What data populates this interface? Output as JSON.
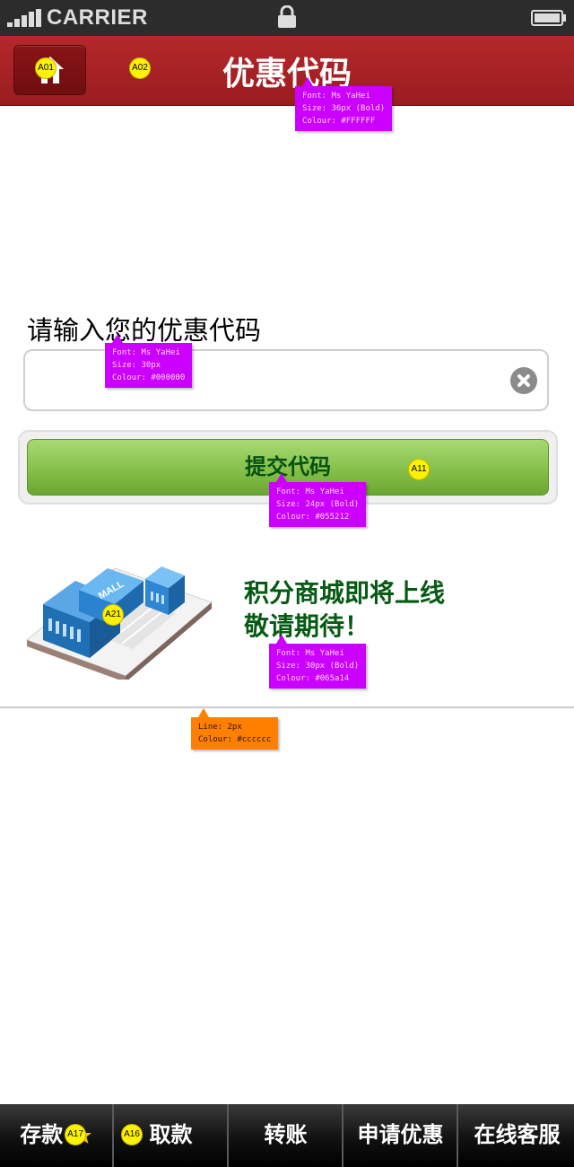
{
  "status_bar": {
    "carrier": "CARRIER",
    "signal_bars": 5,
    "icons": [
      "signal-icon",
      "lock-icon",
      "battery-icon"
    ]
  },
  "header": {
    "title": "优惠代码",
    "home_icon": "home-icon",
    "background": "#a32326"
  },
  "form": {
    "prompt": "请输入您的优惠代码",
    "input_value": "",
    "clear_icon": "clear-icon",
    "submit_label": "提交代码",
    "submit_color": "#055212"
  },
  "promo": {
    "image": "mall-building-illustration",
    "image_sign": "MALL",
    "line1": "积分商城即将上线",
    "line2": "敬请期待！",
    "color": "#065a14"
  },
  "annotations": {
    "markers": [
      "A01",
      "A02",
      "A11",
      "A21",
      "A17",
      "A16"
    ],
    "title_spec": [
      "Font: Ms YaHei",
      "Size: 36px (Bold)",
      "Colour: #FFFFFF"
    ],
    "prompt_spec": [
      "Font: Ms YaHei",
      "Size: 30px",
      "Colour: #000000"
    ],
    "submit_spec": [
      "Font: Ms YaHei",
      "Size: 24px (Bold)",
      "Colour: #055212"
    ],
    "promo_spec": [
      "Font: Ms YaHei",
      "Size: 30px (Bold)",
      "Colour: #065a14"
    ],
    "line_spec": [
      "Line: 2px",
      "Colour: #cccccc"
    ]
  },
  "tabbar": {
    "tabs": [
      {
        "label": "存款"
      },
      {
        "label": "取款"
      },
      {
        "label": "转账"
      },
      {
        "label": "申请优惠"
      },
      {
        "label": "在线客服"
      }
    ]
  }
}
